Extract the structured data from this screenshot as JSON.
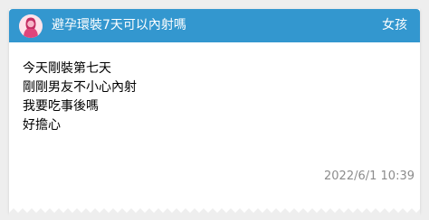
{
  "post": {
    "title": "避孕環裝7天可以內射嗎",
    "board": "女孩",
    "lines": [
      "今天剛裝第七天",
      "剛剛男友不小心內射",
      "我要吃事後嗎",
      "好擔心"
    ],
    "timestamp": "2022/6/1 10:39"
  },
  "colors": {
    "header": "#3397cf",
    "avatar_bg": "#ffe3ea",
    "avatar_fg": "#e0457b"
  },
  "icons": {
    "avatar": "female-avatar-icon"
  }
}
